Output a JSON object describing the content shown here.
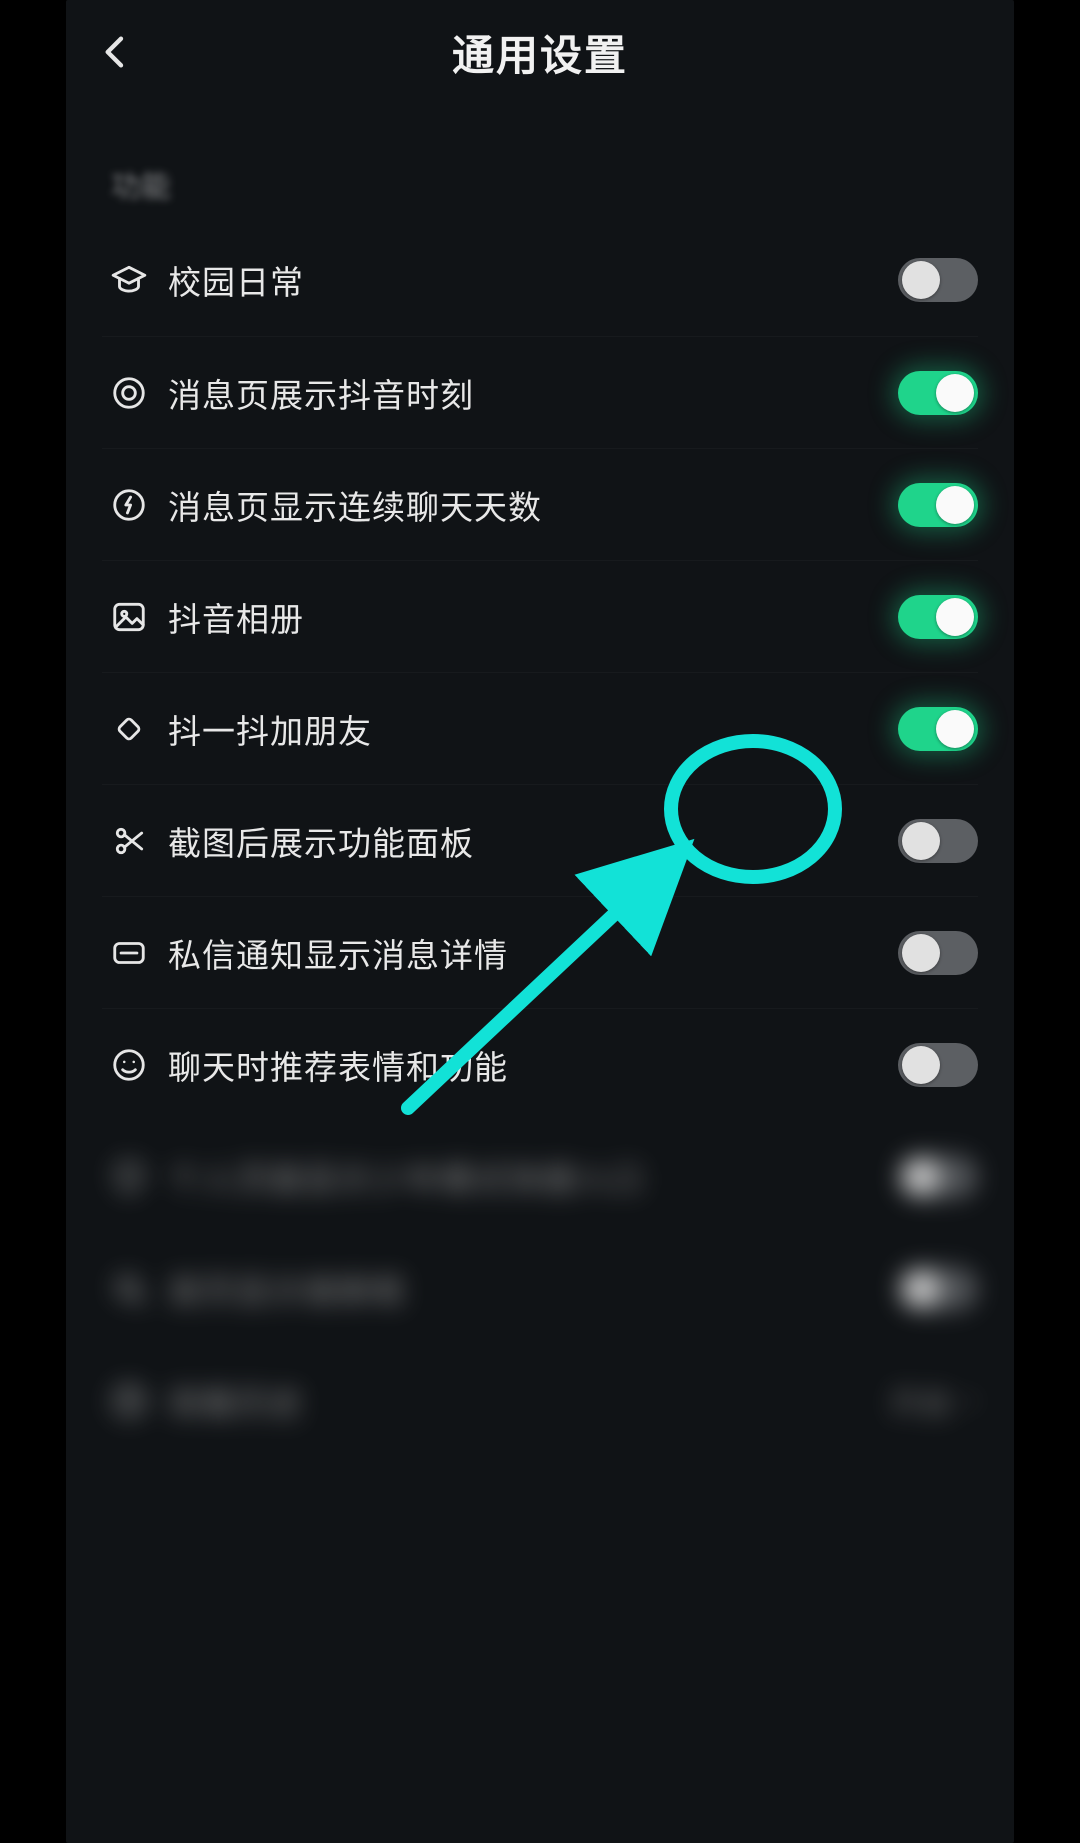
{
  "header": {
    "title": "通用设置"
  },
  "section_label": "功能",
  "rows": [
    {
      "icon": "graduation",
      "label": "校园日常",
      "on": false
    },
    {
      "icon": "target",
      "label": "消息页展示抖音时刻",
      "on": true
    },
    {
      "icon": "bolt",
      "label": "消息页显示连续聊天天数",
      "on": true
    },
    {
      "icon": "gallery",
      "label": "抖音相册",
      "on": true
    },
    {
      "icon": "shake",
      "label": "抖一抖加朋友",
      "on": true
    },
    {
      "icon": "scissors",
      "label": "截图后展示功能面板",
      "on": false,
      "highlight": true
    },
    {
      "icon": "message",
      "label": "私信通知显示消息详情",
      "on": false
    },
    {
      "icon": "smile",
      "label": "聊天时推荐表情和功能",
      "on": false
    }
  ],
  "blurred_rows": [
    {
      "icon": "shield",
      "label": "个人页面显示少年模式快捷入口",
      "type": "toggle",
      "on": false
    },
    {
      "icon": "search",
      "label": "首页显示搜索框",
      "type": "toggle",
      "on": false
    },
    {
      "icon": "history",
      "label": "观看历史",
      "type": "link",
      "value": "开启"
    }
  ],
  "annotation": {
    "color": "#12E2D7"
  }
}
